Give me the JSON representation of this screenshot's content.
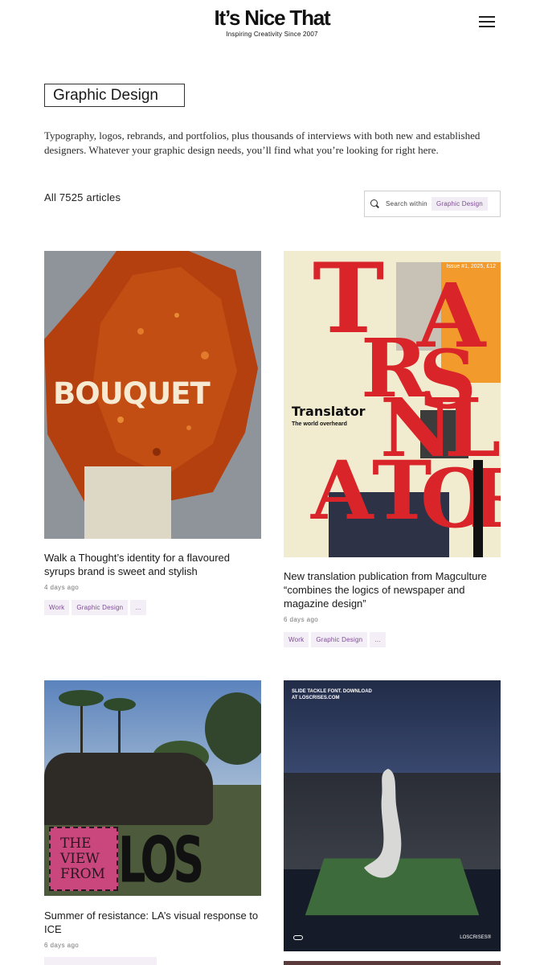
{
  "brand": {
    "title": "It’s Nice That",
    "tagline": "Inspiring Creativity Since 2007"
  },
  "category": {
    "title": "Graphic Design",
    "description": "Typography, logos, rebrands, and portfolios, plus thousands of interviews with both new and established designers. Whatever your graphic design needs, you’ll find what you’re looking for right here."
  },
  "count_label": "All 7525 articles",
  "search": {
    "label": "Search within",
    "chip": "Graphic Design"
  },
  "articles": [
    {
      "title": "Walk a Thought’s identity for a flavoured syrups brand is sweet and stylish",
      "date": "4 days ago",
      "tags": [
        "Work",
        "Graphic Design",
        "..."
      ],
      "image_text": "BOUQUET"
    },
    {
      "title": "New translation publication from Magculture “combines the logics of newspaper and magazine design”",
      "date": "6 days ago",
      "tags": [
        "Work",
        "Graphic Design",
        "..."
      ],
      "image_text": {
        "masthead": "Translator",
        "subtitle": "The world overheard",
        "issue": "Issue #1, 2025, £12"
      }
    },
    {
      "title": "Summer of resistance: LA’s visual response to ICE",
      "date": "6 days ago",
      "tags": [],
      "image_text": {
        "view_from": "THE VIEW FROM",
        "city": "LOS ANGELES"
      }
    },
    {
      "title": "",
      "date": "",
      "tags": [],
      "image_text": {
        "promo": "SLIDE TACKLE FONT. DOWNLOAD AT LOSCRISES.COM",
        "brand": "LOSCRISES®"
      }
    }
  ],
  "colors": {
    "tag_bg": "#f4eef7",
    "tag_text": "#7b4c93",
    "translator_red": "#d9252a",
    "bouquet_amber": "#b5400f"
  }
}
